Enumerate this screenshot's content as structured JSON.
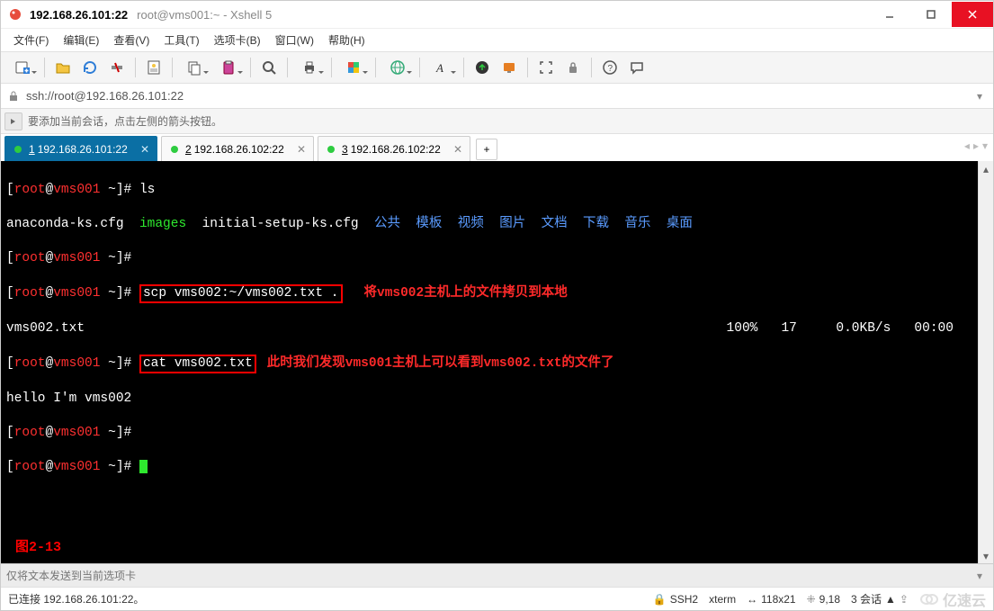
{
  "title": {
    "host": "192.168.26.101:22",
    "session": "root@vms001:~ - Xshell 5"
  },
  "menu": {
    "file": "文件(F)",
    "edit": "编辑(E)",
    "view": "查看(V)",
    "tools": "工具(T)",
    "tabs": "选项卡(B)",
    "window": "窗口(W)",
    "help": "帮助(H)"
  },
  "address": {
    "url": "ssh://root@192.168.26.101:22"
  },
  "hint": {
    "text": "要添加当前会话，点击左侧的箭头按钮。"
  },
  "tabs": [
    {
      "num": "1",
      "label": "192.168.26.101:22",
      "active": true
    },
    {
      "num": "2",
      "label": "192.168.26.102:22",
      "active": false
    },
    {
      "num": "3",
      "label": "192.168.26.102:22",
      "active": false
    }
  ],
  "terminal": {
    "prompt_user": "root",
    "prompt_host": "vms001",
    "prompt_path": "~",
    "cmd_ls": "ls",
    "ls_output_plain1": "anaconda-ks.cfg",
    "ls_images": "images",
    "ls_output_plain2": "initial-setup-ks.cfg",
    "ls_dirs": "公共  模板  视频  图片  文档  下载  音乐  桌面",
    "cmd_scp": "scp vms002:~/vms002.txt .",
    "annot_scp": "将vms002主机上的文件拷贝到本地",
    "transfer_file": "vms002.txt",
    "transfer_pct": "100%",
    "transfer_size": "17",
    "transfer_rate": "0.0KB/s",
    "transfer_eta": "00:00",
    "cmd_cat": "cat vms002.txt",
    "annot_cat": "此时我们发现vms001主机上可以看到vms002.txt的文件了",
    "cat_output": "hello I'm vms002",
    "figure_label": "图2-13"
  },
  "inputstrip": {
    "placeholder": "仅将文本发送到当前选项卡"
  },
  "status": {
    "connected": "已连接 192.168.26.101:22。",
    "ssh": "SSH2",
    "term": "xterm",
    "size": "118x21",
    "cursor": "9,18",
    "sessions": "3 会话"
  },
  "watermark": "亿速云"
}
